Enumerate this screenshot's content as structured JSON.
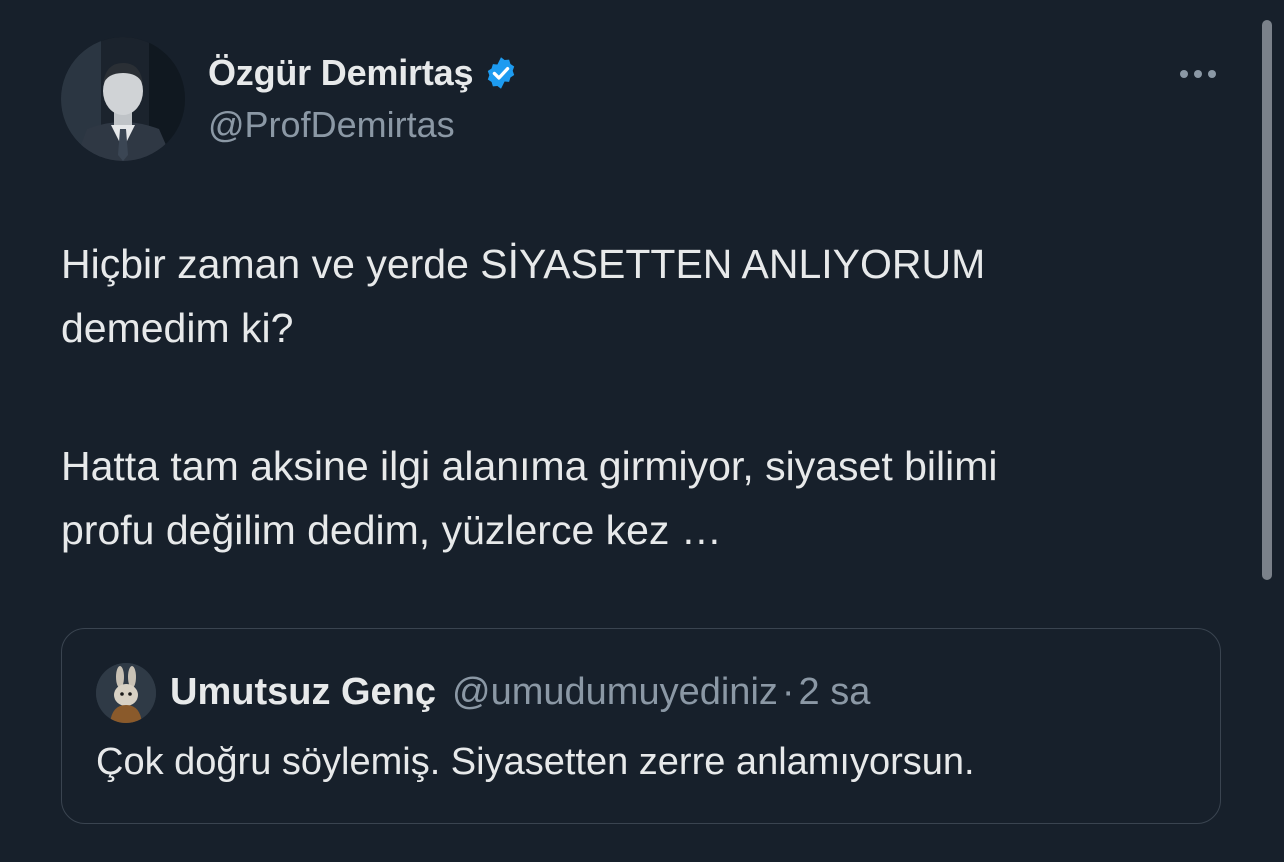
{
  "author": {
    "display_name": "Özgür Demirtaş",
    "handle": "@ProfDemirtas",
    "verified": true,
    "verified_color": "#1d9bf0"
  },
  "tweet": {
    "lines_p1": [
      "Hiçbir zaman ve yerde SİYASETTEN ANLIYORUM",
      "demedim ki?"
    ],
    "lines_p2": [
      "Hatta tam aksine ilgi alanıma girmiyor, siyaset bilimi",
      "profu değilim dedim, yüzlerce kez …"
    ]
  },
  "quoted_tweet": {
    "display_name": "Umutsuz Genç",
    "handle": "@umudumuyediniz",
    "separator": "·",
    "time": "2 sa",
    "text": "Çok doğru söylemiş. Siyasetten zerre anlamıyorsun."
  },
  "icons": {
    "more": "more-horizontal-icon",
    "verified": "verified-badge-icon"
  },
  "colors": {
    "background": "#17202b",
    "text_primary": "#e7e9ea",
    "text_secondary": "#8b98a5",
    "border": "#3a4450"
  }
}
